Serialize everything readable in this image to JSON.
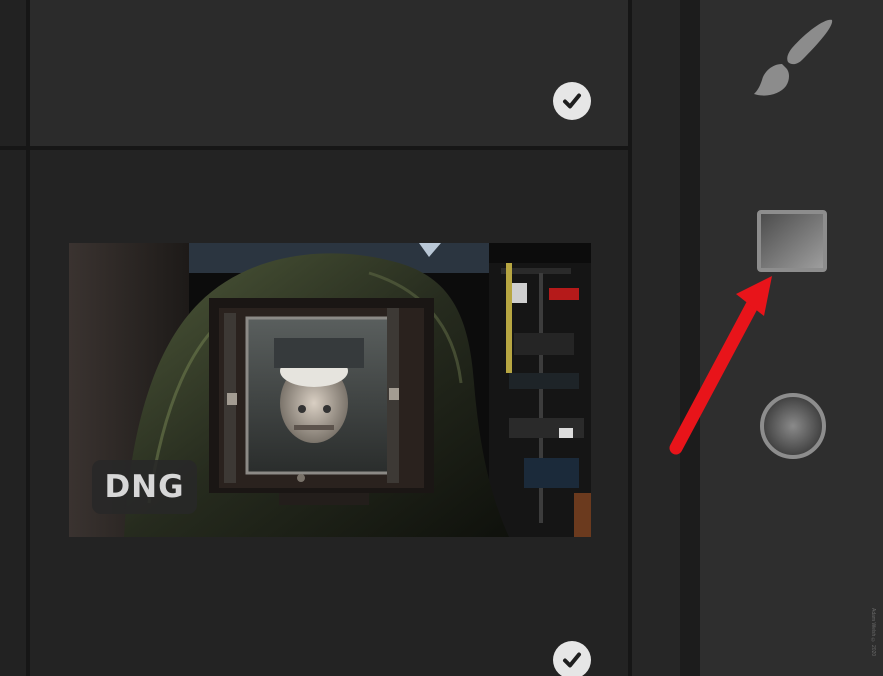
{
  "thumbnail": {
    "file_type_badge": "DNG"
  },
  "cells": [
    {
      "id": "cell-1",
      "selected": true
    },
    {
      "id": "cell-2",
      "selected": true
    }
  ],
  "tools": [
    {
      "name": "brush",
      "icon": "paintbrush-icon"
    },
    {
      "name": "linear-gradient",
      "icon": "linear-gradient-icon",
      "highlighted": true
    },
    {
      "name": "radial-gradient",
      "icon": "radial-gradient-icon"
    }
  ],
  "annotation": {
    "type": "arrow",
    "color": "#e8141a",
    "points_to": "linear-gradient-icon"
  },
  "watermark": "Adam Welsh © 2020",
  "colors": {
    "panel_bg": "#2e2e2e",
    "grid_bg": "#232323",
    "tool_icon": "#8c8c8c",
    "arrow": "#e8141a"
  }
}
